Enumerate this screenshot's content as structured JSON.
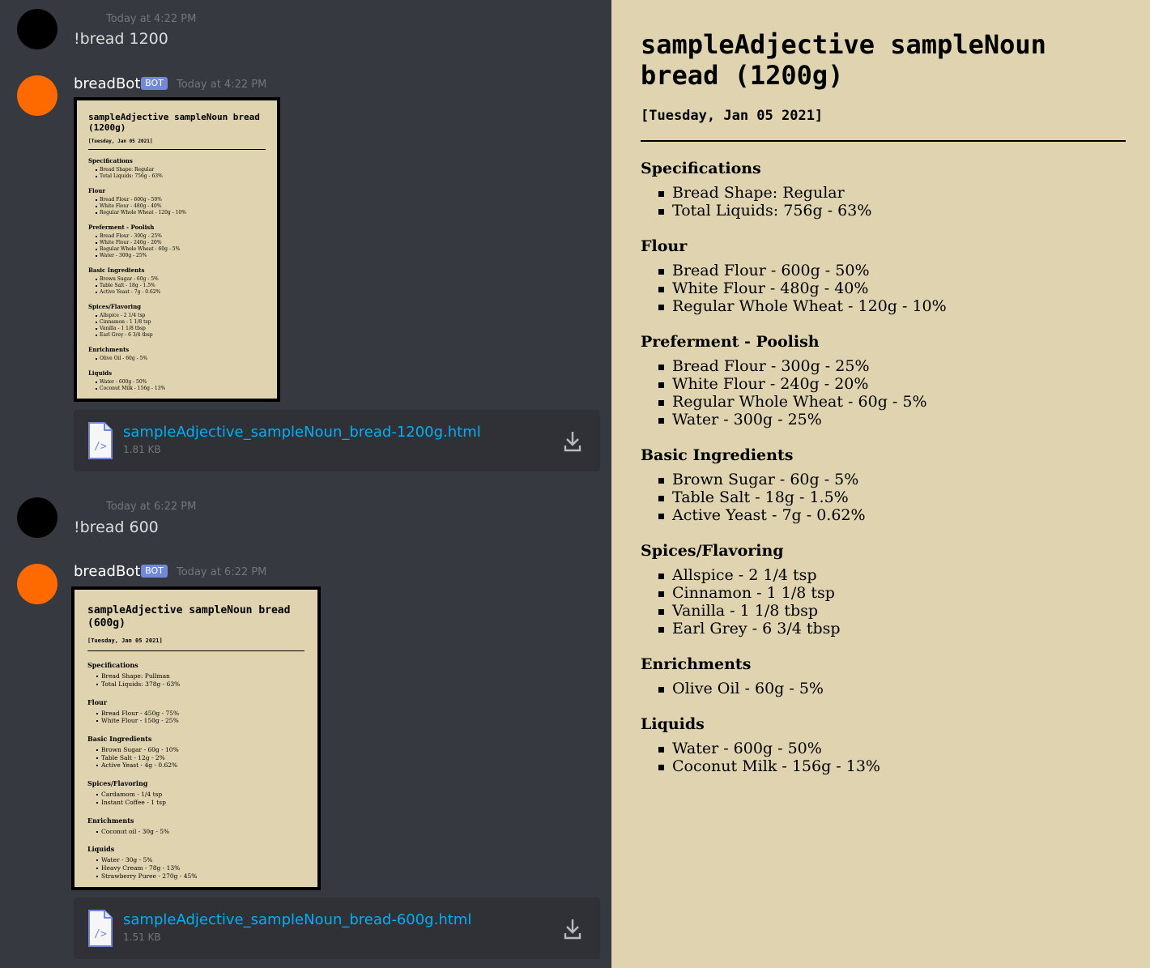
{
  "messages": [
    {
      "kind": "user",
      "time": "Today at 4:22 PM",
      "text": "!bread 1200"
    },
    {
      "kind": "bot",
      "author": "breadBot",
      "badge": "BOT",
      "time": "Today at 4:22 PM",
      "preview": {
        "title": "sampleAdjective sampleNoun bread (1200g)",
        "date": "[Tuesday, Jan 05 2021]",
        "sections": [
          {
            "heading": "Specifications",
            "items": [
              "Bread Shape: Regular",
              "Total Liquids: 756g - 63%"
            ]
          },
          {
            "heading": "Flour",
            "items": [
              "Bread Flour - 600g - 50%",
              "White Flour - 480g - 40%",
              "Regular Whole Wheat - 120g - 10%"
            ]
          },
          {
            "heading": "Preferment - Poolish",
            "items": [
              "Bread Flour - 300g - 25%",
              "White Flour - 240g - 20%",
              "Regular Whole Wheat - 60g - 5%",
              "Water - 300g - 25%"
            ]
          },
          {
            "heading": "Basic Ingredients",
            "items": [
              "Brown Sugar - 60g - 5%",
              "Table Salt - 18g - 1.5%",
              "Active Yeast - 7g - 0.62%"
            ]
          },
          {
            "heading": "Spices/Flavoring",
            "items": [
              "Allspice - 2 1/4 tsp",
              "Cinnamon - 1 1/8 tsp",
              "Vanilla - 1 1/8 tbsp",
              "Earl Grey - 6 3/4 tbsp"
            ]
          },
          {
            "heading": "Enrichments",
            "items": [
              "Olive Oil - 60g - 5%"
            ]
          },
          {
            "heading": "Liquids",
            "items": [
              "Water - 600g - 50%",
              "Coconut Milk - 156g - 13%"
            ]
          }
        ]
      },
      "attachment": {
        "name": "sampleAdjective_sampleNoun_bread-1200g.html",
        "size": "1.81 KB"
      }
    },
    {
      "kind": "user",
      "time": "Today at 6:22 PM",
      "text": "!bread 600"
    },
    {
      "kind": "bot",
      "author": "breadBot",
      "badge": "BOT",
      "time": "Today at 6:22 PM",
      "preview": {
        "title": "sampleAdjective sampleNoun bread (600g)",
        "date": "[Tuesday, Jan 05 2021]",
        "sections": [
          {
            "heading": "Specifications",
            "items": [
              "Bread Shape: Pullman",
              "Total Liquids: 378g - 63%"
            ]
          },
          {
            "heading": "Flour",
            "items": [
              "Bread Flour - 450g - 75%",
              "White Flour - 150g - 25%"
            ]
          },
          {
            "heading": "Basic Ingredients",
            "items": [
              "Brown Sugar - 60g - 10%",
              "Table Salt - 12g - 2%",
              "Active Yeast - 4g - 0.62%"
            ]
          },
          {
            "heading": "Spices/Flavoring",
            "items": [
              "Cardamom - 1/4 tsp",
              "Instant Coffee - 1 tsp"
            ]
          },
          {
            "heading": "Enrichments",
            "items": [
              "Coconut oil - 30g - 5%"
            ]
          },
          {
            "heading": "Liquids",
            "items": [
              "Water - 30g - 5%",
              "Heavy Cream - 78g - 13%",
              "Strawberry Puree - 270g - 45%"
            ]
          }
        ]
      },
      "attachment": {
        "name": "sampleAdjective_sampleNoun_bread-600g.html",
        "size": "1.51 KB"
      }
    }
  ],
  "document": {
    "title_line1": "sampleAdjective sampleNoun",
    "title_line2": "bread (1200g)",
    "date": "[Tuesday, Jan 05 2021]",
    "sections": [
      {
        "heading": "Specifications",
        "items": [
          "Bread Shape: Regular",
          "Total Liquids: 756g - 63%"
        ]
      },
      {
        "heading": "Flour",
        "items": [
          "Bread Flour - 600g - 50%",
          "White Flour - 480g - 40%",
          "Regular Whole Wheat - 120g - 10%"
        ]
      },
      {
        "heading": "Preferment - Poolish",
        "items": [
          "Bread Flour - 300g - 25%",
          "White Flour - 240g - 20%",
          "Regular Whole Wheat - 60g - 5%",
          "Water - 300g - 25%"
        ]
      },
      {
        "heading": "Basic Ingredients",
        "items": [
          "Brown Sugar - 60g - 5%",
          "Table Salt - 18g - 1.5%",
          "Active Yeast - 7g - 0.62%"
        ]
      },
      {
        "heading": "Spices/Flavoring",
        "items": [
          "Allspice - 2 1/4 tsp",
          "Cinnamon - 1 1/8 tsp",
          "Vanilla - 1 1/8 tbsp",
          "Earl Grey - 6 3/4 tbsp"
        ]
      },
      {
        "heading": "Enrichments",
        "items": [
          "Olive Oil - 60g - 5%"
        ]
      },
      {
        "heading": "Liquids",
        "items": [
          "Water - 600g - 50%",
          "Coconut Milk - 156g - 13%"
        ]
      }
    ]
  },
  "colors": {
    "chat_bg": "#36393f",
    "attachment_bg": "#2f3136",
    "paper": "#dfd3b0",
    "bot_avatar": "#ff6a00",
    "user_avatar": "#000000",
    "link": "#00b0f4",
    "badge": "#7289da"
  },
  "icons": {
    "file": "code-file-icon",
    "download": "download-icon"
  }
}
